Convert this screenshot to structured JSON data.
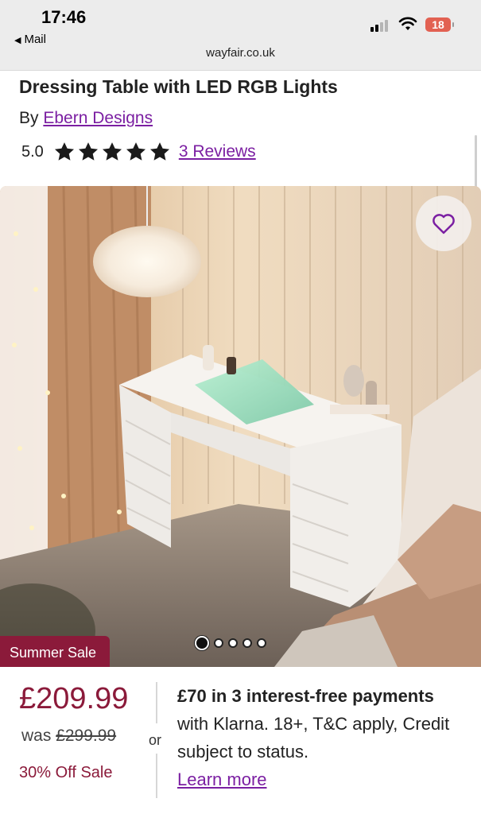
{
  "status_bar": {
    "time": "17:46",
    "back_label": "Mail",
    "url": "wayfair.co.uk",
    "battery": "18"
  },
  "product": {
    "title": "Dressing Table with LED RGB Lights",
    "by_prefix": "By",
    "brand": "Ebern Designs",
    "rating_value": "5.0",
    "stars": 5,
    "reviews_label": "3 Reviews"
  },
  "gallery": {
    "sale_badge": "Summer Sale",
    "slide_count": 5,
    "active_slide": 1
  },
  "pricing": {
    "price": "£209.99",
    "was_prefix": "was",
    "was_price": "£299.99",
    "discount": "30% Off Sale",
    "or_label": "or",
    "klarna_bold_1": "£70 in 3 interest-free payments",
    "klarna_text": " with Klarna. 18+, T&C apply, Credit subject to status.",
    "learn_more": "Learn more"
  },
  "colors": {
    "accent_purple": "#7b1fa2",
    "sale_red": "#8b1a3a"
  }
}
